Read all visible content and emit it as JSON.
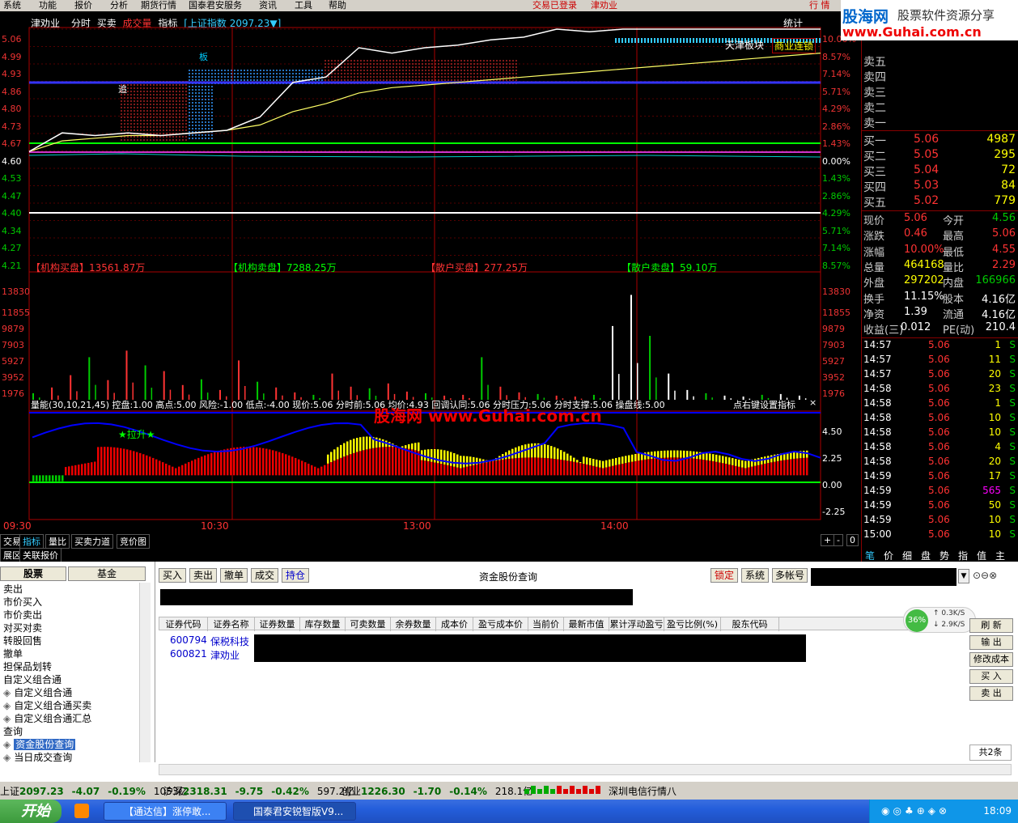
{
  "menu": [
    "系统",
    "功能",
    "报价",
    "分析",
    "期货行情",
    "国泰君安服务",
    "资讯",
    "工具",
    "帮助"
  ],
  "menu_right": {
    "login": "交易已登录",
    "stock": "津劝业",
    "view": "行 情"
  },
  "watermark": {
    "brand": "股海网",
    "slogan": "股票软件资源分享",
    "url": "www.Guhai.com.cn",
    "center_url": "股海网 www.Guhai.com.cn"
  },
  "chart_header": {
    "name": "津劝业",
    "tabs": [
      "分时",
      "买卖",
      "成交量",
      "指标"
    ],
    "index": "[上证指数 2097.23▼]",
    "stat": "统计"
  },
  "chart_data": [
    {
      "type": "line",
      "title": "分时",
      "y_left": [
        "5.06",
        "4.99",
        "4.93",
        "4.86",
        "4.80",
        "4.73",
        "4.67",
        "4.60",
        "4.53",
        "4.47",
        "4.40",
        "4.34",
        "4.27",
        "4.21"
      ],
      "y_right": [
        "10.00%",
        "8.57%",
        "7.14%",
        "5.71%",
        "4.29%",
        "2.86%",
        "1.43%",
        "0.00%",
        "1.43%",
        "2.86%",
        "4.29%",
        "5.71%",
        "7.14%",
        "8.57%"
      ],
      "ylim": [
        4.21,
        5.06
      ],
      "x_ticks": [
        "09:30",
        "10:30",
        "13:00",
        "14:00"
      ],
      "annotations": [
        "板",
        "追",
        "天津板块",
        "商业连锁"
      ],
      "series": [
        {
          "name": "price",
          "values": [
            4.6,
            4.67,
            4.66,
            4.67,
            4.66,
            4.67,
            4.68,
            4.73,
            4.86,
            4.88,
            4.99,
            4.97,
            4.99,
            5.0,
            5.02,
            5.03,
            5.06,
            5.05,
            5.06,
            5.06,
            5.06,
            5.06,
            5.06,
            5.06,
            5.06
          ]
        },
        {
          "name": "avg",
          "values": [
            4.6,
            4.64,
            4.65,
            4.66,
            4.66,
            4.67,
            4.68,
            4.7,
            4.75,
            4.78,
            4.82,
            4.84,
            4.85,
            4.86,
            4.87,
            4.88,
            4.89,
            4.9,
            4.91,
            4.92,
            4.93,
            4.94,
            4.95,
            4.96,
            4.97
          ]
        }
      ]
    },
    {
      "type": "bar",
      "title": "成交量",
      "labels": {
        "inst_buy": "【机构买盘】13561.87万",
        "inst_sell": "【机构卖盘】7288.25万",
        "retail_buy": "【散户买盘】277.25万",
        "retail_sell": "【散户卖盘】59.10万"
      },
      "y_ticks": [
        "13830",
        "11855",
        "9879",
        "7903",
        "5927",
        "3952",
        "1976"
      ],
      "ylim": [
        0,
        13830
      ],
      "values": [
        800,
        1500,
        3000,
        5200,
        2400,
        6000,
        4200,
        3500,
        1800,
        2500,
        1200,
        4800,
        2200,
        1500,
        900,
        600,
        3200,
        1600,
        1400,
        2000,
        1000,
        800,
        500,
        600,
        5200,
        1600,
        900,
        700,
        500,
        400,
        600,
        9000,
        12800,
        7800,
        3200,
        1200,
        800,
        500,
        400,
        600,
        700,
        500
      ]
    },
    {
      "type": "bar",
      "title": "量能",
      "labels": {
        "header": "量能(30,10,21,45) 控盘:1.00 高点:5.00 风险:-1.00 低点:-4.00 现价:5.06 分时前:5.06 均价:4.93 回调认同:5.06 分时压力:5.06 分时支撑:5.06 操盘线:5.00",
        "hint": "点右键设置指标",
        "pull": "★拉升★"
      },
      "y_ticks": [
        "4.50",
        "2.25",
        "0.00",
        "-2.25"
      ],
      "ylim": [
        -2.5,
        5
      ]
    }
  ],
  "bottom_tabs": [
    "交易",
    "指标",
    "量比",
    "买卖力道",
    "竞价图"
  ],
  "bottom_tabs2": [
    "展区",
    "关联报价"
  ],
  "quote": {
    "sell": [
      {
        "l": "卖五"
      },
      {
        "l": "卖四"
      },
      {
        "l": "卖三"
      },
      {
        "l": "卖二"
      },
      {
        "l": "卖一"
      }
    ],
    "buy": [
      {
        "l": "买一",
        "p": "5.06",
        "v": "4987"
      },
      {
        "l": "买二",
        "p": "5.05",
        "v": "295"
      },
      {
        "l": "买三",
        "p": "5.04",
        "v": "72"
      },
      {
        "l": "买四",
        "p": "5.03",
        "v": "84"
      },
      {
        "l": "买五",
        "p": "5.02",
        "v": "779"
      }
    ],
    "stats": [
      {
        "a": "现价",
        "b": "5.06",
        "c": "今开",
        "d": "4.56"
      },
      {
        "a": "涨跌",
        "b": "0.46",
        "c": "最高",
        "d": "5.06"
      },
      {
        "a": "涨幅",
        "b": "10.00%",
        "c": "最低",
        "d": "4.55"
      },
      {
        "a": "总量",
        "b": "464168",
        "c": "量比",
        "d": "2.29"
      },
      {
        "a": "外盘",
        "b": "297202",
        "c": "内盘",
        "d": "166966"
      },
      {
        "a": "换手",
        "b": "11.15%",
        "c": "股本",
        "d": "4.16亿"
      },
      {
        "a": "净资",
        "b": "1.39",
        "c": "流通",
        "d": "4.16亿"
      },
      {
        "a": "收益(三)",
        "b": "0.012",
        "c": "PE(动)",
        "d": "210.4"
      }
    ],
    "ticks": [
      {
        "t": "14:57",
        "p": "5.06",
        "v": "1",
        "s": "S"
      },
      {
        "t": "14:57",
        "p": "5.06",
        "v": "11",
        "s": "S"
      },
      {
        "t": "14:57",
        "p": "5.06",
        "v": "20",
        "s": "S"
      },
      {
        "t": "14:58",
        "p": "5.06",
        "v": "23",
        "s": "S"
      },
      {
        "t": "14:58",
        "p": "5.06",
        "v": "1",
        "s": "S"
      },
      {
        "t": "14:58",
        "p": "5.06",
        "v": "10",
        "s": "S"
      },
      {
        "t": "14:58",
        "p": "5.06",
        "v": "10",
        "s": "S"
      },
      {
        "t": "14:58",
        "p": "5.06",
        "v": "4",
        "s": "S"
      },
      {
        "t": "14:58",
        "p": "5.06",
        "v": "20",
        "s": "S"
      },
      {
        "t": "14:59",
        "p": "5.06",
        "v": "17",
        "s": "S"
      },
      {
        "t": "14:59",
        "p": "5.06",
        "v": "565",
        "s": "S"
      },
      {
        "t": "14:59",
        "p": "5.06",
        "v": "50",
        "s": "S"
      },
      {
        "t": "14:59",
        "p": "5.06",
        "v": "10",
        "s": "S"
      },
      {
        "t": "15:00",
        "p": "5.06",
        "v": "10",
        "s": "S"
      }
    ],
    "bottom_tabs": [
      "笔",
      "价",
      "细",
      "盘",
      "势",
      "指",
      "值",
      "主"
    ]
  },
  "trade": {
    "tree_tabs": [
      "股票",
      "基金"
    ],
    "tree": [
      "卖出",
      "市价买入",
      "市价卖出",
      "对买对卖",
      "转股回售",
      "撤单",
      "担保品划转",
      "自定义组合通",
      "自定义组合通",
      "自定义组合通买卖",
      "自定义组合通汇总",
      "查询",
      "资金股份查询",
      "当日成交查询"
    ],
    "toolbar": [
      "买入",
      "卖出",
      "撤单",
      "成交",
      "持仓"
    ],
    "title": "资金股份查询",
    "right_buttons": [
      "锁定",
      "系统",
      "多帐号"
    ],
    "columns": [
      "证券代码",
      "证券名称",
      "证券数量",
      "库存数量",
      "可卖数量",
      "余券数量",
      "成本价",
      "盈亏成本价",
      "当前价",
      "最新市值",
      "累计浮动盈亏",
      "盈亏比例(%)",
      "股东代码"
    ],
    "rows": [
      {
        "code": "600794",
        "name": "保税科技"
      },
      {
        "code": "600821",
        "name": "津劝业"
      }
    ],
    "side_buttons": [
      "刷 新",
      "输 出",
      "修改成本",
      "买 入",
      "卖 出"
    ],
    "net": {
      "pct": "36%",
      "up": "0.3K/S",
      "down": "2.9K/S"
    },
    "count": "共2条"
  },
  "status": {
    "sh": {
      "l": "上证",
      "v": "2097.23",
      "c": "-4.07",
      "p": "-0.19%",
      "a": "1053亿"
    },
    "sz": {
      "l": "沪深",
      "v": "2318.31",
      "c": "-9.75",
      "p": "-0.42%",
      "a": "597.2亿"
    },
    "cy": {
      "l": "创业",
      "v": "1226.30",
      "c": "-1.70",
      "p": "-0.14%",
      "a": "218.1亿"
    },
    "line": "深圳电信行情八"
  },
  "taskbar": {
    "start": "开始",
    "items": [
      "【通达信】涨停敢...",
      "国泰君安锐智版V9..."
    ],
    "clock": "18:09"
  },
  "colors": {
    "up": "#ff3333",
    "down": "#00cc00",
    "yellow": "#ffff00",
    "blue": "#3366ff"
  }
}
